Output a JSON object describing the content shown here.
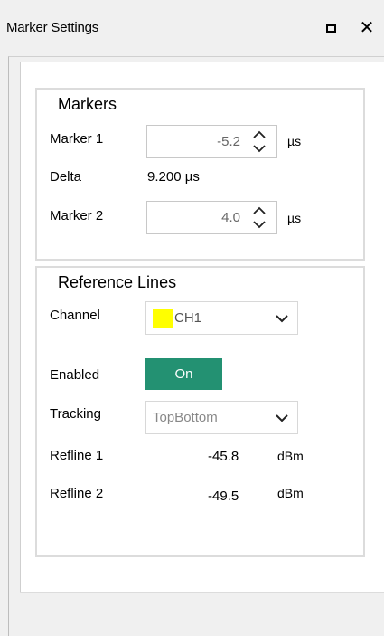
{
  "window": {
    "title": "Marker Settings",
    "maximize_icon": "maximize-icon",
    "close_icon": "close-icon"
  },
  "markers": {
    "title": "Markers",
    "marker1": {
      "label": "Marker 1",
      "value": "-5.2",
      "unit": "µs"
    },
    "delta": {
      "label": "Delta",
      "value": "9.200 µs"
    },
    "marker2": {
      "label": "Marker 2",
      "value": "4.0",
      "unit": "µs"
    }
  },
  "reference_lines": {
    "title": "Reference Lines",
    "channel": {
      "label": "Channel",
      "value": "CH1",
      "swatch_color": "#ffff00"
    },
    "enabled": {
      "label": "Enabled",
      "value": "On",
      "color": "#239172"
    },
    "tracking": {
      "label": "Tracking",
      "value": "TopBottom"
    },
    "refline1": {
      "label": "Refline 1",
      "value": "-45.8",
      "unit": "dBm"
    },
    "refline2": {
      "label": "Refline 2",
      "value": "-49.5",
      "unit": "dBm"
    }
  }
}
